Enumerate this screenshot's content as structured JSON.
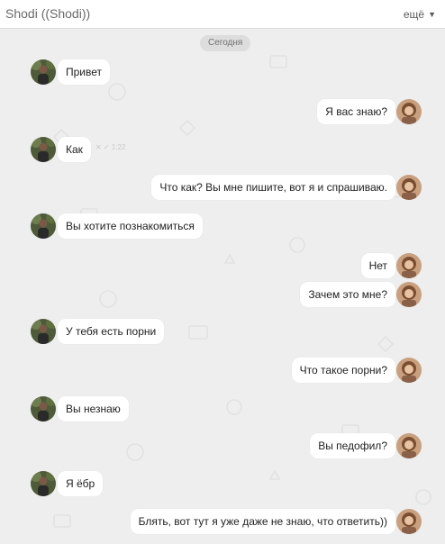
{
  "header": {
    "title": "Shodi ((Shodi))",
    "more_label": "ещё",
    "more_arrow": "▼"
  },
  "date_separator": "Сегодня",
  "ghost_text": "✕ ✓ 1:22",
  "messages": [
    {
      "side": "in",
      "text": "Привет"
    },
    {
      "side": "out",
      "text": "Я вас знаю?"
    },
    {
      "side": "in",
      "text": "Как"
    },
    {
      "side": "out",
      "text": "Что как? Вы мне пишите, вот я и спрашиваю."
    },
    {
      "side": "in",
      "text": "Вы хотите познакомиться"
    },
    {
      "side": "out",
      "text": "Нет"
    },
    {
      "side": "out",
      "text": "Зачем это мне?"
    },
    {
      "side": "in",
      "text": "У тебя есть порни"
    },
    {
      "side": "out",
      "text": "Что такое порни?"
    },
    {
      "side": "in",
      "text": "Вы незнаю"
    },
    {
      "side": "out",
      "text": "Вы педофил?"
    },
    {
      "side": "in",
      "text": "Я ёбр"
    },
    {
      "side": "out",
      "text": "Блять, вот тут я уже даже не знаю, что ответить))"
    }
  ],
  "colors": {
    "background": "#eeeeee",
    "bubble": "#ffffff",
    "header": "#ffffff"
  }
}
